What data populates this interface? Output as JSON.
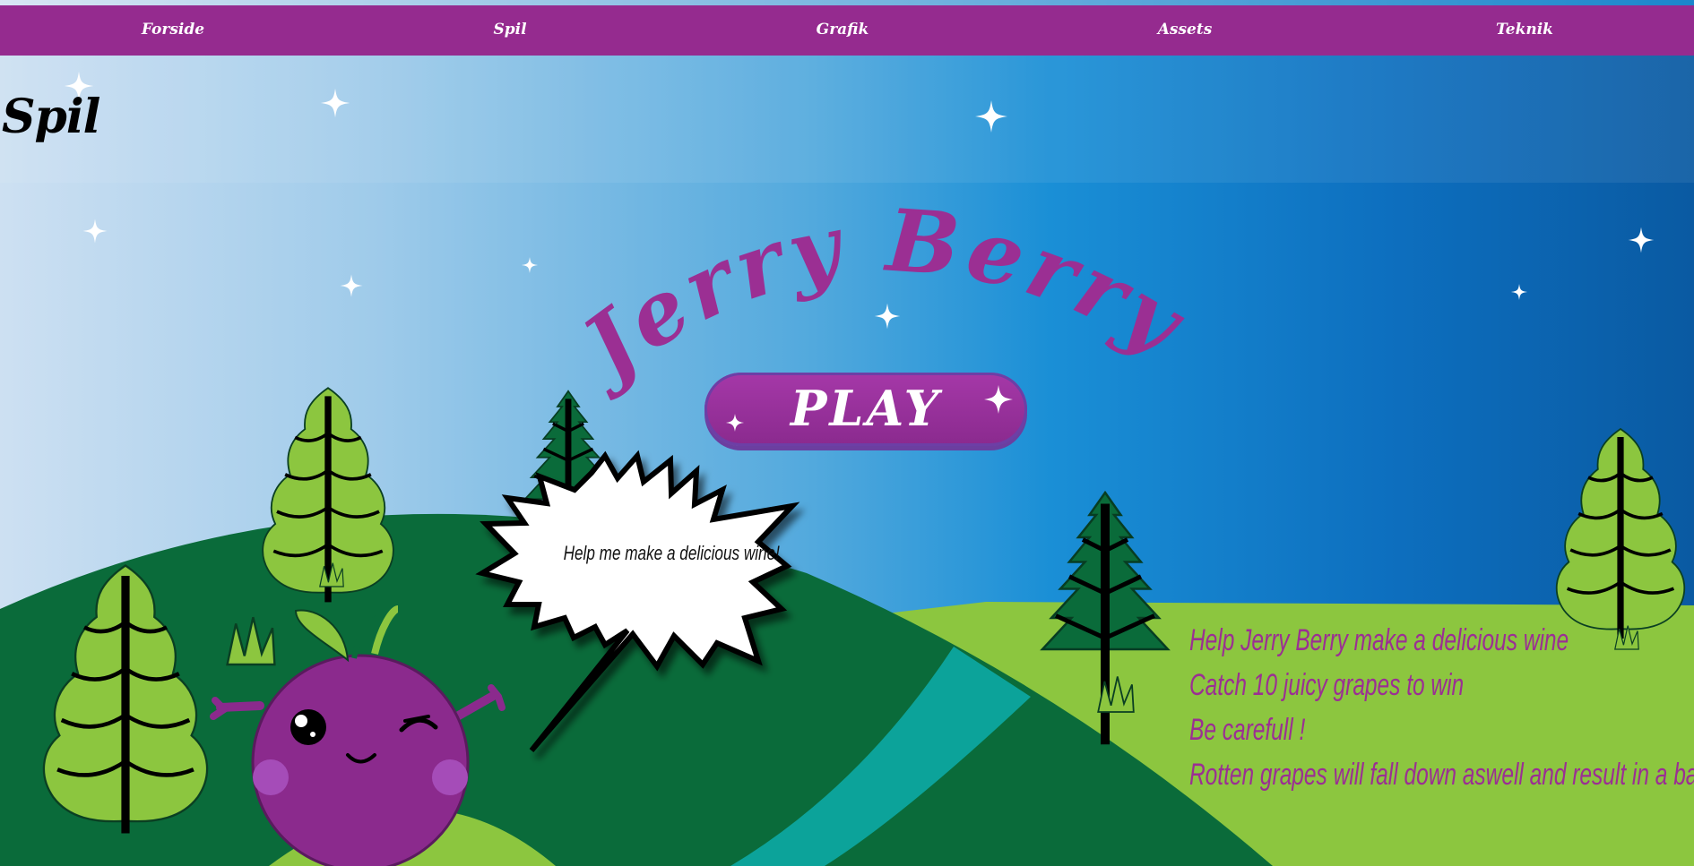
{
  "nav": {
    "items": [
      {
        "label": "Forside"
      },
      {
        "label": "Spil"
      },
      {
        "label": "Grafik"
      },
      {
        "label": "Assets"
      },
      {
        "label": "Teknik"
      }
    ]
  },
  "page": {
    "heading": "Spil"
  },
  "game": {
    "title": "Jerry Berry",
    "play_label": "PLAY",
    "speech_bubble": "Help me make a delicious wine!",
    "instructions": [
      "Help  Jerry Berry make a delicious wine",
      "Catch 10 juicy grapes to win",
      "Be carefull !",
      "Rotten grapes will fall down aswell and result in a bad wine"
    ]
  },
  "colors": {
    "nav_bg": "#952b8f",
    "title_purple": "#9b2f93",
    "dark_green": "#0a6b3a",
    "light_green": "#8cc63f",
    "teal_path": "#0ca39a"
  },
  "icons": [
    "sparkle-icon",
    "tree-icon",
    "grass-icon",
    "berry-character"
  ]
}
